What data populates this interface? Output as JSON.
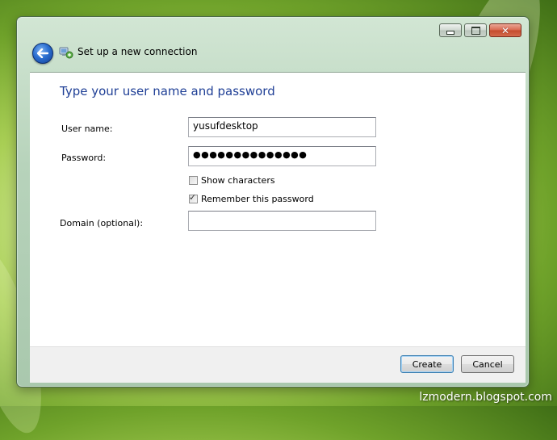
{
  "window": {
    "title": "Set up a new connection",
    "buttons": {
      "minimize_icon": "minimize-icon",
      "maximize_icon": "maximize-icon",
      "close_icon": "close-icon"
    }
  },
  "form": {
    "heading": "Type your user name and password",
    "username_label": "User name:",
    "username_value": "yusufdesktop",
    "password_label": "Password:",
    "password_mask": "●●●●●●●●●●●●●●",
    "show_characters_label": "Show characters",
    "show_characters_checked": false,
    "remember_password_label": "Remember this password",
    "remember_password_checked": true,
    "domain_label": "Domain (optional):",
    "domain_value": ""
  },
  "footer": {
    "create_label": "Create",
    "cancel_label": "Cancel"
  },
  "watermark": "lzmodern.blogspot.com",
  "colors": {
    "heading": "#1f3f96",
    "accent": "#2b6fd0"
  }
}
